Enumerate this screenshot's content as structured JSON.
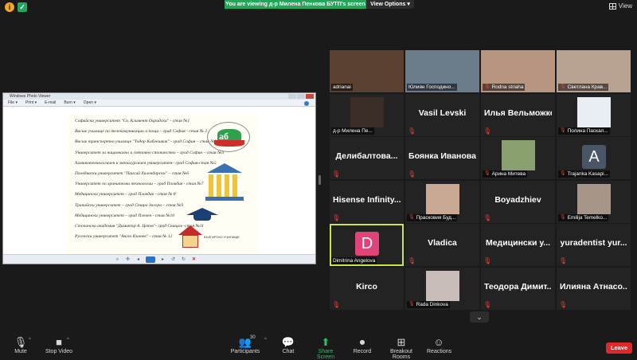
{
  "meeting": {
    "banner_text": "You are viewing д-р Милена Пенкова БУТП's screen",
    "view_options_label": "View Options ▾",
    "view_label": "View",
    "info_icon": "info-icon",
    "encryption_icon": "shield-check-icon"
  },
  "shared_window": {
    "title": "Windows Photo Viewer",
    "menu": [
      "File ▾",
      "Print ▾",
      "E-mail",
      "Burn ▾",
      "Open ▾"
    ],
    "document": {
      "lines": [
        "Софийски университет \"Св. Климент Охридски\" - стая №1",
        "Висше училище по телекомуникации и пощи – град София - стая № 2",
        "Висше транспортно училище \"Тодор Каблешков\" - град София – стая №3",
        "Университет за национално и световно стопанство – град София – стая №4",
        "Химикотехнологичен и металургичен университет– град София-стая №5",
        "Пловдивски университет \"Паисий Хилендарски\" – стая №6",
        "Университет по хранителни технологии – град Пловдив - стая №7",
        "Медицински университет – град Пловдив - стая № 8",
        "Тракийски университет – град Стара Загора – стая №9",
        "Медицински университет – град Плевен - стая №10",
        "Стопанска академия \"Димитър А. Ценов\"- град Свищов -стая №11",
        "Русенски университет \"Ангел Кънчев\" - стая № 12"
      ],
      "logo_text": "аб",
      "school_caption": "БЪЛГАРСКО УЧИЛИЩЕ"
    }
  },
  "participants": [
    {
      "label": "adrianai",
      "name": "",
      "type": "photo",
      "photo": "#5a4030",
      "muted": false
    },
    {
      "label": "Юлиян Господино...",
      "name": "",
      "type": "photo",
      "photo": "#6a7b8a",
      "muted": false
    },
    {
      "label": "Rodna striaha",
      "name": "",
      "type": "photo",
      "photo": "#b89580",
      "muted": true
    },
    {
      "label": "Светлана Крав...",
      "name": "",
      "type": "photo",
      "photo": "#b8a292",
      "muted": true
    },
    {
      "label": "д-р Милена Пе...",
      "name": "",
      "type": "photo",
      "photo": "#3b2d28",
      "muted": false
    },
    {
      "label": "",
      "name": "Vasil Levski",
      "type": "name",
      "muted": true
    },
    {
      "label": "",
      "name": "Илья Вельможко",
      "type": "name",
      "muted": true
    },
    {
      "label": "Полина Паскал...",
      "name": "",
      "type": "photo",
      "photo": "#e8eef4",
      "muted": true
    },
    {
      "label": "",
      "name": "Делибалтова...",
      "type": "name",
      "muted": true
    },
    {
      "label": "",
      "name": "Боянка Иванова",
      "type": "name",
      "muted": true
    },
    {
      "label": "Арина Митева",
      "name": "",
      "type": "photo",
      "photo": "#8aa070",
      "muted": true
    },
    {
      "label": "Trajanka Kasapi...",
      "name": "",
      "type": "letter",
      "letter": "A",
      "color": "#4a5568",
      "muted": true
    },
    {
      "label": "",
      "name": "Hisense Infinity...",
      "type": "name",
      "muted": true
    },
    {
      "label": "Прасковия Буд...",
      "name": "",
      "type": "photo",
      "photo": "#c9a894",
      "muted": true
    },
    {
      "label": "",
      "name": "Boyadzhiev",
      "type": "name",
      "muted": true
    },
    {
      "label": "Emilija Temelko...",
      "name": "",
      "type": "photo",
      "photo": "#a8958a",
      "muted": true
    },
    {
      "label": "Dimitrina Angelova",
      "name": "",
      "type": "letter",
      "letter": "D",
      "color": "#e0437a",
      "muted": false,
      "active": true
    },
    {
      "label": "",
      "name": "Vladica",
      "type": "name",
      "muted": true
    },
    {
      "label": "",
      "name": "Медицински у...",
      "type": "name",
      "muted": true
    },
    {
      "label": "",
      "name": "yuradentist yur...",
      "type": "name",
      "muted": true
    },
    {
      "label": "",
      "name": "Kirco",
      "type": "name",
      "muted": true
    },
    {
      "label": "Rada Dinkova",
      "name": "",
      "type": "photo",
      "photo": "#c8bdb8",
      "muted": true
    },
    {
      "label": "",
      "name": "Теодора Димит...",
      "type": "name",
      "muted": true
    },
    {
      "label": "",
      "name": "Илияна Атнасо...",
      "type": "name",
      "muted": true
    }
  ],
  "toolbar": {
    "mute": "Mute",
    "stop_video": "Stop Video",
    "participants": "Participants",
    "participants_count": "30",
    "chat": "Chat",
    "share_screen": "Share Screen",
    "record": "Record",
    "breakout_rooms": "Breakout Rooms",
    "reactions": "Reactions",
    "leave": "Leave"
  },
  "colors": {
    "accent_green": "#23a55a",
    "leave_red": "#e02828",
    "active_speaker": "#c8e64a"
  }
}
